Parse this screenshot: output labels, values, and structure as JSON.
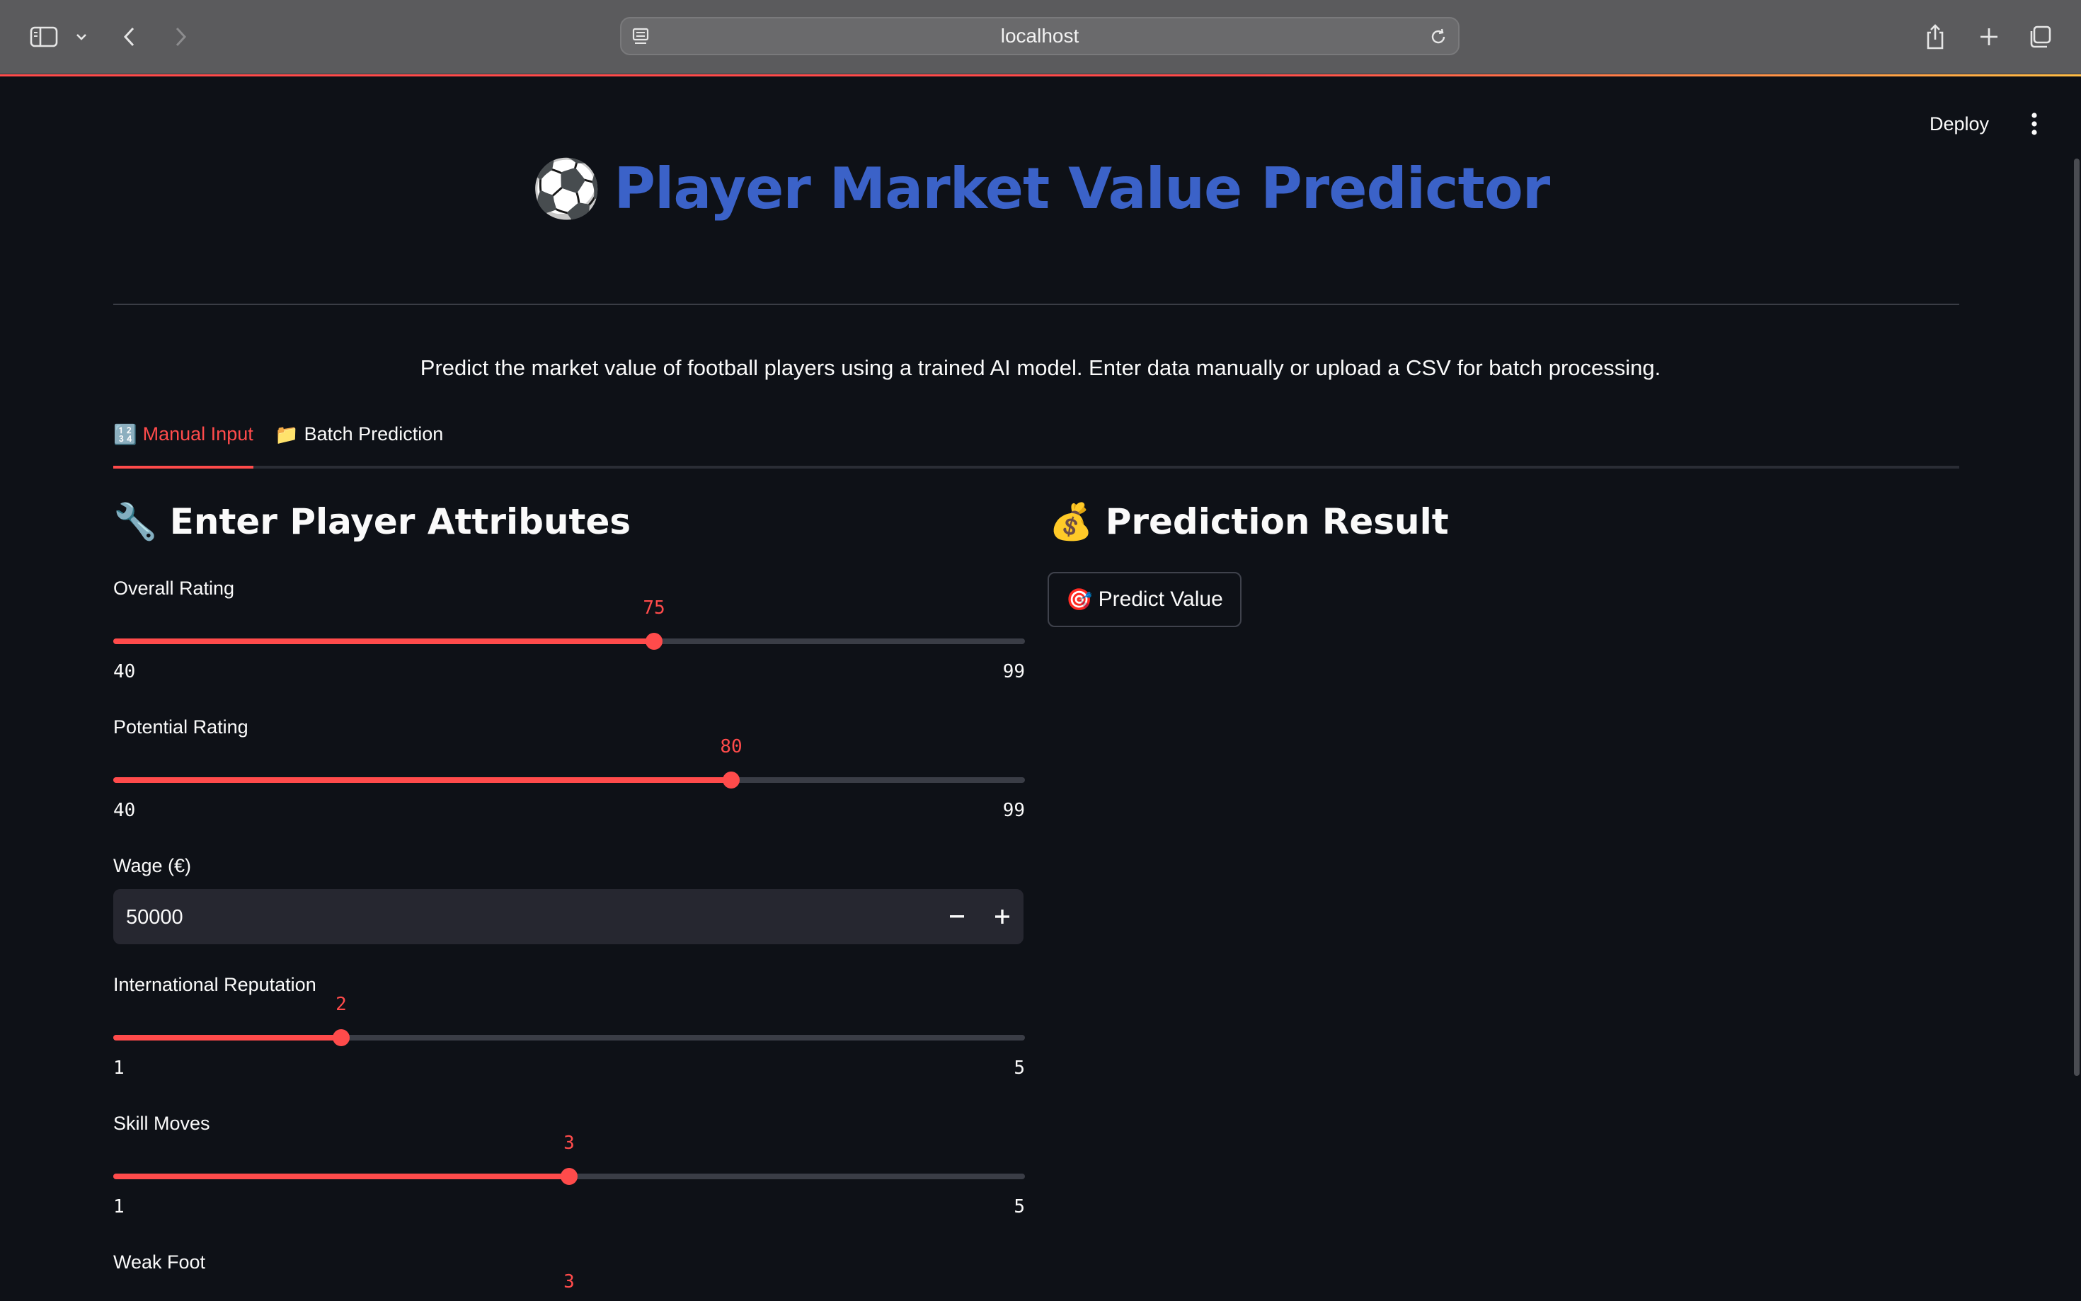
{
  "browser": {
    "url": "localhost"
  },
  "header": {
    "deploy_label": "Deploy"
  },
  "page": {
    "title_emoji": "⚽",
    "title": "Player Market Value Predictor",
    "subtitle": "Predict the market value of football players using a trained AI model. Enter data manually or upload a CSV for batch processing."
  },
  "tabs": [
    {
      "emoji": "🔢",
      "label": "Manual Input",
      "active": true
    },
    {
      "emoji": "📁",
      "label": "Batch Prediction",
      "active": false
    }
  ],
  "left": {
    "heading_emoji": "🔧",
    "heading": "Enter Player Attributes",
    "overall": {
      "label": "Overall Rating",
      "value": "75",
      "min": "40",
      "max": "99"
    },
    "potential": {
      "label": "Potential Rating",
      "value": "80",
      "min": "40",
      "max": "99"
    },
    "wage": {
      "label": "Wage (€)",
      "value": "50000"
    },
    "reputation": {
      "label": "International Reputation",
      "value": "2",
      "min": "1",
      "max": "5"
    },
    "skill": {
      "label": "Skill Moves",
      "value": "3",
      "min": "1",
      "max": "5"
    },
    "weakfoot": {
      "label": "Weak Foot",
      "value": "3"
    }
  },
  "right": {
    "heading_emoji": "💰",
    "heading": "Prediction Result",
    "predict_emoji": "🎯",
    "predict_label": "Predict Value"
  },
  "colors": {
    "accent": "#ff4b4b",
    "title_blue": "#3b62c8",
    "background": "#0e1117"
  }
}
